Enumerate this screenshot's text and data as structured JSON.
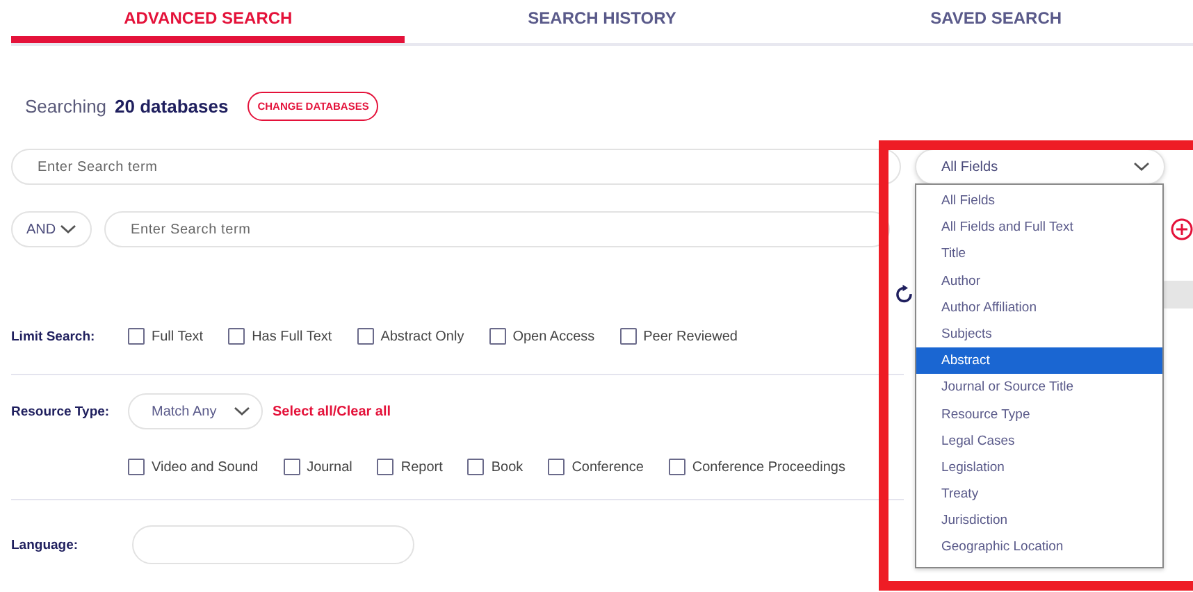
{
  "tabs": [
    {
      "label": "ADVANCED SEARCH",
      "selected": true
    },
    {
      "label": "SEARCH HISTORY",
      "selected": false
    },
    {
      "label": "SAVED SEARCH",
      "selected": false
    }
  ],
  "searching": {
    "prefix": "Searching",
    "count": "20 databases",
    "button": "CHANGE DATABASES"
  },
  "search_rows": [
    {
      "placeholder": "Enter Search term",
      "field": "All Fields",
      "expanded": true
    },
    {
      "operator": "AND",
      "placeholder": "Enter Search term"
    }
  ],
  "field_menu": [
    {
      "label": "All Fields",
      "selected": false
    },
    {
      "label": "All Fields and Full Text",
      "selected": false
    },
    {
      "label": "Title",
      "selected": false
    },
    {
      "label": "Author",
      "selected": false
    },
    {
      "label": "Author Affiliation",
      "selected": false
    },
    {
      "label": "Subjects",
      "selected": false
    },
    {
      "label": "Abstract",
      "selected": true
    },
    {
      "label": "Journal or Source Title",
      "selected": false
    },
    {
      "label": "Resource Type",
      "selected": false
    },
    {
      "label": "Legal Cases",
      "selected": false
    },
    {
      "label": "Legislation",
      "selected": false
    },
    {
      "label": "Treaty",
      "selected": false
    },
    {
      "label": "Jurisdiction",
      "selected": false
    },
    {
      "label": "Geographic Location",
      "selected": false
    }
  ],
  "limit_search": {
    "label": "Limit Search:",
    "options": [
      {
        "label": "Full Text",
        "checked": false
      },
      {
        "label": "Has Full Text",
        "checked": false
      },
      {
        "label": "Abstract Only",
        "checked": false
      },
      {
        "label": "Open Access",
        "checked": false
      },
      {
        "label": "Peer Reviewed",
        "checked": false
      }
    ]
  },
  "resource_type": {
    "label": "Resource Type:",
    "match": "Match Any",
    "select_all": "Select all/Clear all",
    "options": [
      {
        "label": "Video and Sound",
        "checked": false
      },
      {
        "label": "Journal",
        "checked": false
      },
      {
        "label": "Report",
        "checked": false
      },
      {
        "label": "Book",
        "checked": false
      },
      {
        "label": "Conference",
        "checked": false
      },
      {
        "label": "Conference Proceedings",
        "checked": false
      }
    ]
  },
  "language": {
    "label": "Language:"
  }
}
